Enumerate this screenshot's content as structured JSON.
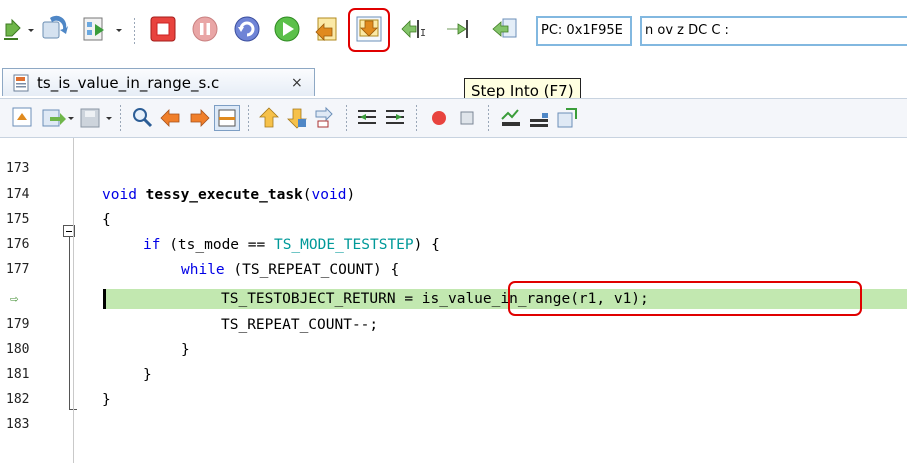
{
  "toolbar": {
    "pc_display": "PC: 0x1F95E",
    "flags_display": "n ov z DC C  :",
    "icons": [
      "step-back-icon",
      "reload-icon",
      "run-config-icon",
      "stop-icon",
      "suspend-icon",
      "restart-icon",
      "resume-icon",
      "step-return-icon",
      "step-into-icon",
      "step-over-icon",
      "run-to-line-icon",
      "step-out-icon"
    ]
  },
  "tooltip": {
    "text": "Step Into (F7)"
  },
  "editor_tab": {
    "label": "ts_is_value_in_range_s.c",
    "close_glyph": "×"
  },
  "toolbar2": {
    "icons": [
      "new-debug-icon",
      "open-icon",
      "save-icon",
      "search-icon",
      "go-back-icon",
      "go-forward-icon",
      "memory-icon",
      "step-up-icon",
      "step-down-icon",
      "step-both-icon",
      "indent-left-icon",
      "indent-right-icon",
      "breakpoint-icon",
      "stop-square-icon",
      "chart-icon",
      "bars-icon",
      "export-icon"
    ]
  },
  "code": {
    "lines": [
      {
        "number": "173",
        "text": ""
      },
      {
        "number": "174",
        "text": "void tessy_execute_task(void)"
      },
      {
        "number": "175",
        "text": "{"
      },
      {
        "number": "176",
        "text": "if (ts_mode == TS_MODE_TESTSTEP) {"
      },
      {
        "number": "177",
        "text": "while (TS_REPEAT_COUNT) {"
      },
      {
        "number": "⇨",
        "text": "TS_TESTOBJECT_RETURN = is_value_in_range(r1, v1);"
      },
      {
        "number": "179",
        "text": "TS_REPEAT_COUNT--;"
      },
      {
        "number": "180",
        "text": "}"
      },
      {
        "number": "181",
        "text": "}"
      },
      {
        "number": "182",
        "text": "}"
      },
      {
        "number": "183",
        "text": ""
      }
    ],
    "tokens": {
      "void1": "void",
      "func_name": "tessy_execute_task",
      "paren_open": "(",
      "void2": "void",
      "paren_close": ")",
      "if": "if",
      "if_cond_a": " (ts_mode == ",
      "ts_mode_teststep": "TS_MODE_TESTSTEP",
      "if_cond_b": ") {",
      "while": "while",
      "while_cond": " (TS_REPEAT_COUNT) {",
      "assign_lhs": "TS_TESTOBJECT_RETURN = ",
      "call_expr": "is_value_in_range(r1, v1);"
    }
  }
}
